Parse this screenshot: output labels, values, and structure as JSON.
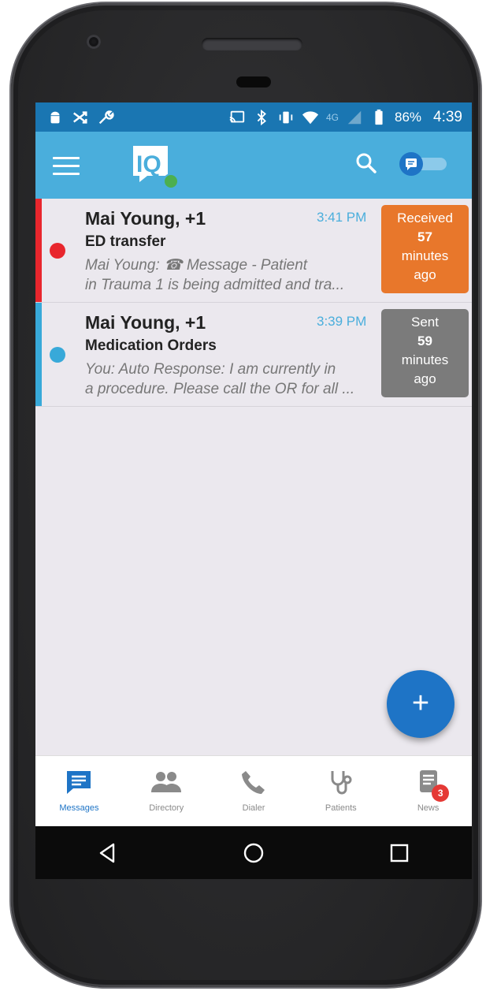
{
  "status_bar": {
    "battery": "86%",
    "clock": "4:39",
    "network": "4G"
  },
  "conversations": [
    {
      "name": "Mai Young, +1",
      "time": "3:41 PM",
      "subject": "ED transfer",
      "preview_line1": "Mai Young: ☎ Message - Patient",
      "preview_line2": "in Trauma 1 is being admitted and  tra...",
      "badge_status": "Received",
      "badge_number": "57",
      "badge_unit": "minutes",
      "badge_suffix": "ago",
      "accent_color": "#e8262d",
      "badge_color": "#e8772b"
    },
    {
      "name": "Mai Young, +1",
      "time": "3:39 PM",
      "subject": "Medication Orders",
      "preview_line1": "You: Auto Response: I am currently in",
      "preview_line2": "a procedure. Please call the OR for all ...",
      "badge_status": "Sent",
      "badge_number": "59",
      "badge_unit": "minutes",
      "badge_suffix": "ago",
      "accent_color": "#38a9d9",
      "badge_color": "#7b7b7b"
    }
  ],
  "fab": {
    "label": "+"
  },
  "bottom_nav": [
    {
      "label": "Messages",
      "icon": "message-icon",
      "active": true
    },
    {
      "label": "Directory",
      "icon": "people-icon"
    },
    {
      "label": "Dialer",
      "icon": "phone-icon"
    },
    {
      "label": "Patients",
      "icon": "stethoscope-icon"
    },
    {
      "label": "News",
      "icon": "news-icon",
      "badge": "3"
    }
  ],
  "colors": {
    "status_bar": "#1a76b2",
    "app_bar": "#4aaedc",
    "active_nav": "#1e74c6",
    "fab": "#1e74c6"
  }
}
